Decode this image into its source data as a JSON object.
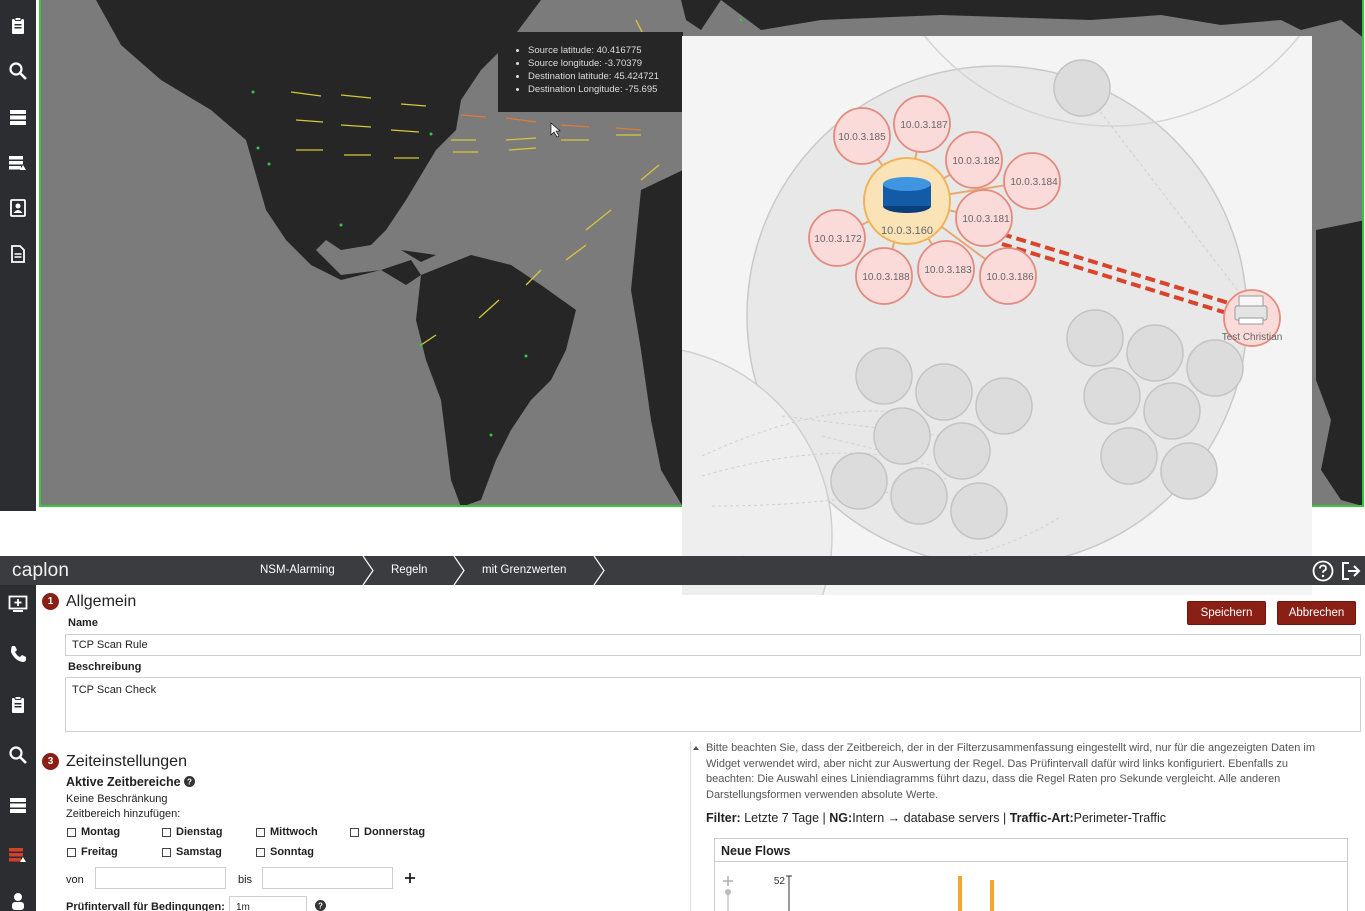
{
  "map": {
    "tooltip": [
      "Source latitude: 40.416775",
      "Source longitude: -3.70379",
      "Destination latitude: 45.424721",
      "Destination Longitude: -75.695"
    ],
    "colors": {
      "background": "#7b7b7b",
      "land": "#262626",
      "border": "#35c83a",
      "flow_lines": "#d9c63a"
    }
  },
  "graph": {
    "hub_label": "10.0.3.160",
    "nodes": [
      {
        "label": "10.0.3.185"
      },
      {
        "label": "10.0.3.187"
      },
      {
        "label": "10.0.3.182"
      },
      {
        "label": "10.0.3.184"
      },
      {
        "label": "10.0.3.181"
      },
      {
        "label": "10.0.3.172"
      },
      {
        "label": "10.0.3.188"
      },
      {
        "label": "10.0.3.183"
      },
      {
        "label": "10.0.3.186"
      }
    ],
    "printer_label": "Test Christian"
  },
  "header": {
    "brand": "caplon",
    "breadcrumbs": [
      "NSM-Alarming",
      "Regeln",
      "mit Grenzwerten"
    ]
  },
  "form": {
    "section1": {
      "number": "1",
      "title": "Allgemein"
    },
    "name_label": "Name",
    "name_value": "TCP Scan Rule",
    "description_label": "Beschreibung",
    "description_value": "TCP Scan Check",
    "save_label": "Speichern",
    "cancel_label": "Abbrechen",
    "section3": {
      "number": "3",
      "title": "Zeiteinstellungen"
    },
    "active_ranges_label": "Aktive Zeitbereiche",
    "no_restriction": "Keine Beschränkung",
    "add_range_label": "Zeitbereich hinzufügen:",
    "days": [
      "Montag",
      "Dienstag",
      "Mittwoch",
      "Donnerstag",
      "Freitag",
      "Samstag",
      "Sonntag"
    ],
    "from_label": "von",
    "to_label": "bis",
    "interval_label": "Prüfintervall für Bedingungen:",
    "interval_value": "1m"
  },
  "info": {
    "text": "Bitte beachten Sie, dass der Zeitbereich, der in der Filterzusammenfassung eingestellt wird, nur für die angezeigten Daten im Widget verwendet wird, aber nicht zur Auswertung der Regel. Das Prüfintervall dafür wird links konfiguriert. Ebenfalls zu beachten: Die Auswahl eines Liniendiagramms führt dazu, dass die Regel Raten pro Sekunde vergleicht. Alle anderen Darstellungsformen verwenden absolute Werte.",
    "filter_label": "Filter:",
    "filter_time": "Letzte 7 Tage",
    "filter_ng_label": "NG:",
    "filter_ng_value": "Intern → database servers",
    "filter_traffic_label": "Traffic-Art:",
    "filter_traffic_value": "Perimeter-Traffic",
    "separator": "|"
  },
  "flows": {
    "title": "Neue Flows",
    "y_max_label": "52"
  }
}
